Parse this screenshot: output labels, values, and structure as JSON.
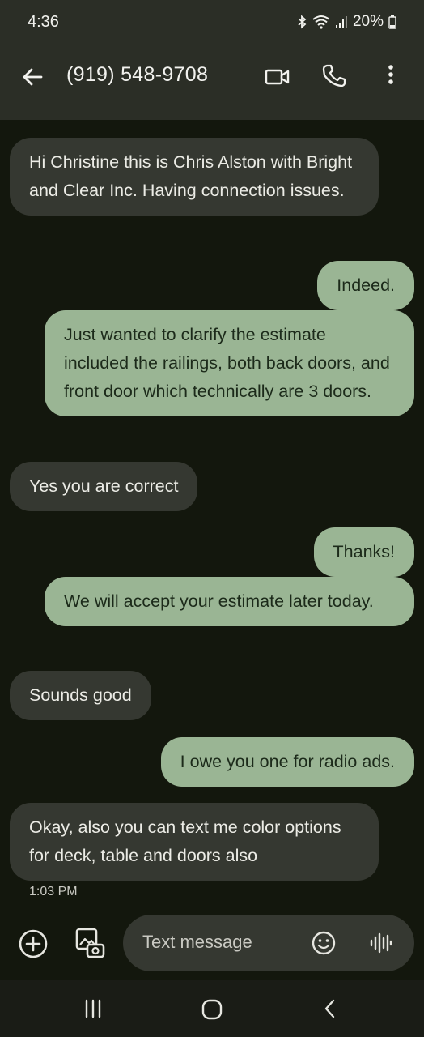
{
  "status_bar": {
    "time": "4:36",
    "battery": "20%",
    "icons": [
      "bluetooth-icon",
      "wifi-icon",
      "signal-icon",
      "battery-icon"
    ]
  },
  "header": {
    "title": "(919) 548-9708",
    "icons": [
      "back-arrow-icon",
      "video-call-icon",
      "phone-icon",
      "more-vert-icon"
    ]
  },
  "messages": [
    {
      "direction": "incoming",
      "text": "Hi Christine this is Chris Alston with Bright and Clear Inc. Having connection issues."
    },
    {
      "direction": "outgoing",
      "text": "Indeed."
    },
    {
      "direction": "outgoing",
      "text": "Just wanted to clarify the estimate included the railings, both back doors, and front door which technically are 3 doors."
    },
    {
      "direction": "incoming",
      "text": "Yes you are correct"
    },
    {
      "direction": "outgoing",
      "text": "Thanks!"
    },
    {
      "direction": "outgoing",
      "text": "We will accept your estimate later today."
    },
    {
      "direction": "incoming",
      "text": "Sounds good"
    },
    {
      "direction": "outgoing",
      "text": "I owe you one for radio ads."
    },
    {
      "direction": "incoming",
      "text": "Okay, also you can text me color options for deck, table and doors also"
    }
  ],
  "last_message_time": "1:03 PM",
  "composer": {
    "placeholder": "Text message",
    "icons": [
      "add-icon",
      "gallery-icon",
      "emoji-icon",
      "voice-icon"
    ]
  },
  "nav_bar": {
    "icons": [
      "recents-icon",
      "home-icon",
      "back-icon"
    ]
  },
  "colors": {
    "background": "#13170d",
    "app_bar": "#2b2e26",
    "incoming_bubble": "#353831",
    "outgoing_bubble": "#9ab594"
  }
}
